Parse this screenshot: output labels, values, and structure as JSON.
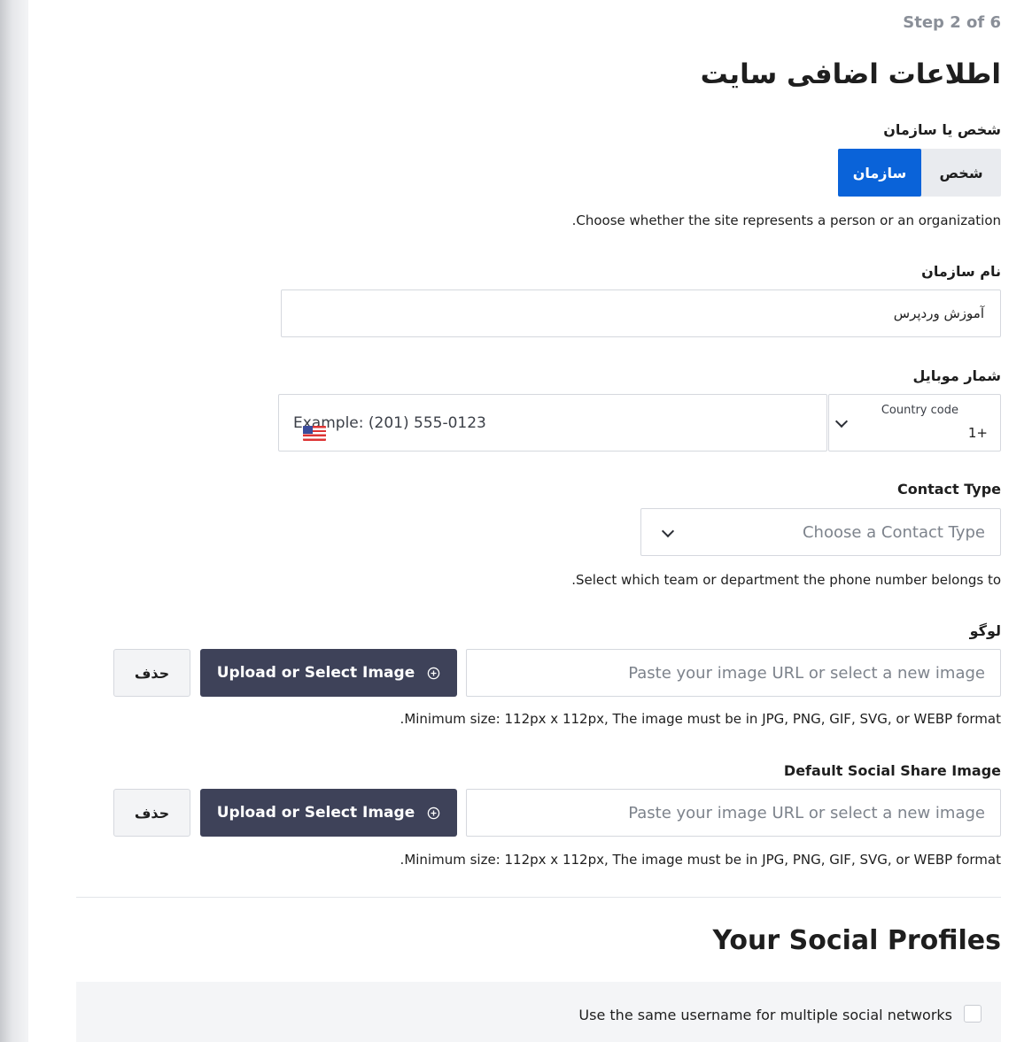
{
  "step": "Step 2 of 6",
  "title": "اطلاعات اضافی سایت",
  "entity": {
    "label": "شخص یا سازمان",
    "options": [
      "شخص",
      "سازمان"
    ],
    "selected": "سازمان",
    "help": ".Choose whether the site represents a person or an organization"
  },
  "org_name": {
    "label": "نام سازمان",
    "value": "آموزش وردپرس"
  },
  "mobile": {
    "label": "شمار موبایل",
    "placeholder": "Example: (201) 555-0123",
    "country_code_label": "Country code",
    "country_code_value": "1+"
  },
  "contact_type": {
    "label": "Contact Type",
    "placeholder": "Choose a Contact Type",
    "help": ".Select which team or department the phone number belongs to"
  },
  "logo": {
    "label": "لوگو",
    "placeholder": "Paste your image URL or select a new image",
    "upload_label": "Upload or Select Image",
    "remove_label": "حذف",
    "help": ".Minimum size: 112px x 112px, The image must be in JPG, PNG, GIF, SVG, or WEBP format"
  },
  "share_image": {
    "label": "Default Social Share Image",
    "placeholder": "Paste your image URL or select a new image",
    "upload_label": "Upload or Select Image",
    "remove_label": "حذف",
    "help": ".Minimum size: 112px x 112px, The image must be in JPG, PNG, GIF, SVG, or WEBP format"
  },
  "social": {
    "title": "Your Social Profiles",
    "same_username_label": "Use the same username for multiple social networks"
  },
  "icons": {
    "upload": "plus-circle-icon",
    "dropdown": "chevron-down-icon",
    "flag": "us-flag-icon"
  }
}
